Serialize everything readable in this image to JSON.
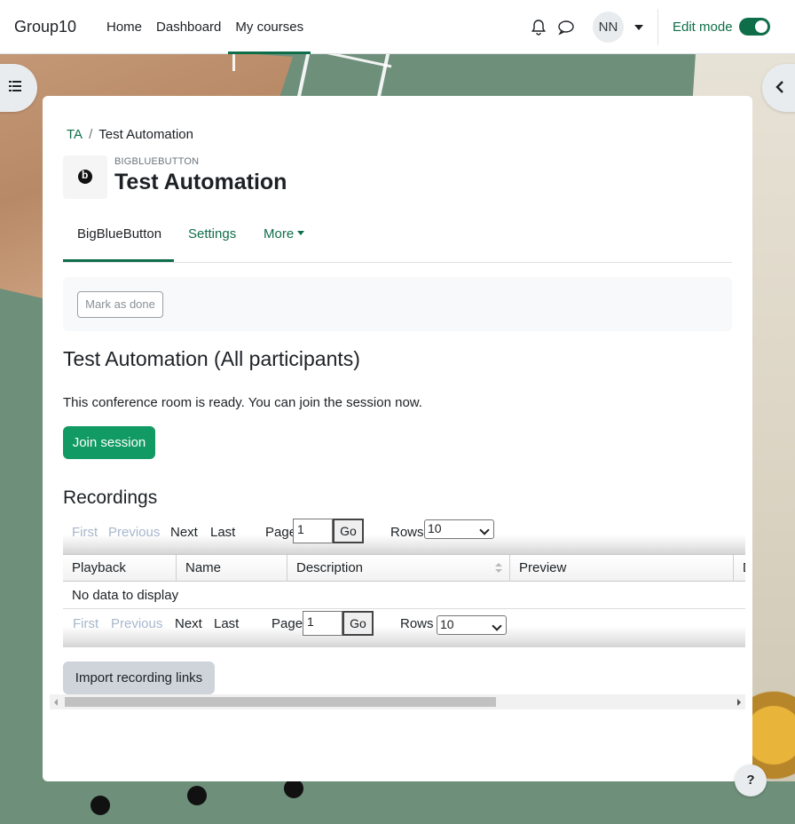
{
  "navbar": {
    "brand": "Group10",
    "links": [
      "Home",
      "Dashboard",
      "My courses"
    ],
    "active_link": "My courses",
    "avatar_initials": "NN",
    "edit_mode_label": "Edit mode",
    "edit_mode_on": true,
    "icons": [
      "bell-icon",
      "chat-icon",
      "chevron-down-icon"
    ]
  },
  "breadcrumb": {
    "items": [
      "TA",
      "Test Automation"
    ],
    "separator": "/"
  },
  "header": {
    "module_type": "BIGBLUEBUTTON",
    "title": "Test Automation",
    "module_icon": "bigbluebutton-icon"
  },
  "tabs": {
    "items": [
      "BigBlueButton",
      "Settings",
      "More"
    ],
    "active": "BigBlueButton"
  },
  "completion": {
    "mark_done_label": "Mark as done"
  },
  "session": {
    "title": "Test Automation (All participants)",
    "status_text": "This conference room is ready. You can join the session now.",
    "join_label": "Join session"
  },
  "recordings": {
    "title": "Recordings",
    "pager": {
      "first": "First",
      "previous": "Previous",
      "next": "Next",
      "last": "Last",
      "page_label": "Page",
      "page_value": "1",
      "go_label": "Go",
      "rows_label": "Rows",
      "rows_value": "10"
    },
    "columns": [
      "Playback",
      "Name",
      "Description",
      "Preview",
      "D"
    ],
    "empty_message": "No data to display",
    "import_label": "Import recording links"
  },
  "help": {
    "label": "?"
  },
  "colors": {
    "accent": "#0f6e4a",
    "join_button": "#119a63",
    "disabled_link": "#a7b7cc"
  }
}
